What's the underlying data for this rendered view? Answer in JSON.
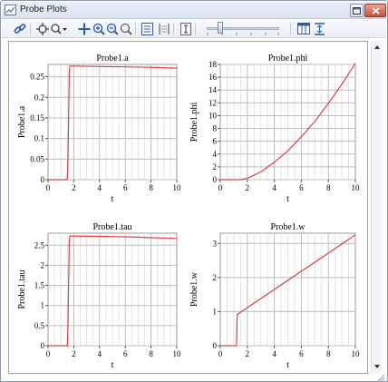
{
  "window": {
    "title": "Probe Plots",
    "accent": "#cc3b2c"
  },
  "toolbar": {
    "icons": [
      "link-icon",
      "pan-crosshair-icon",
      "zoom-axis-dropdown-icon",
      "move-icon",
      "zoom-in-icon",
      "zoom-out-icon",
      "zoom-reset-icon",
      "grid-view-icon",
      "align-icon",
      "text-cursor-icon",
      "layout-columns-icon",
      "fit-vertical-icon"
    ]
  },
  "plots": [
    {
      "title": "Probe1.a",
      "xlabel": "t",
      "ylabel": "Probe1.a",
      "xticks": [
        "0",
        "2",
        "4",
        "6",
        "8",
        "10"
      ],
      "yticks": [
        "0",
        "0.05",
        "0.1",
        "0.15",
        "0.2",
        "0.25"
      ]
    },
    {
      "title": "Probe1.phi",
      "xlabel": "t",
      "ylabel": "Probe1.phi",
      "xticks": [
        "0",
        "2",
        "4",
        "6",
        "8",
        "10"
      ],
      "yticks": [
        "0",
        "2",
        "4",
        "6",
        "8",
        "10",
        "12",
        "14",
        "16",
        "18"
      ]
    },
    {
      "title": "Probe1.tau",
      "xlabel": "t",
      "ylabel": "Probe1.tau",
      "xticks": [
        "0",
        "2",
        "4",
        "6",
        "8",
        "10"
      ],
      "yticks": [
        "0",
        "0.5",
        "1",
        "1.5",
        "2",
        "2.5"
      ]
    },
    {
      "title": "Probe1.w",
      "xlabel": "t",
      "ylabel": "Probe1.w",
      "xticks": [
        "0",
        "2",
        "4",
        "6",
        "8",
        "10"
      ],
      "yticks": [
        "0",
        "1",
        "2",
        "3"
      ]
    }
  ],
  "chart_data": [
    {
      "type": "line",
      "title": "Probe1.a",
      "xlabel": "t",
      "ylabel": "Probe1.a",
      "xlim": [
        0,
        10
      ],
      "ylim": [
        0,
        0.28
      ],
      "grid": true,
      "x": [
        0,
        1.5,
        1.55,
        1.6,
        1.65,
        1.7,
        2,
        4,
        6,
        8,
        10
      ],
      "y": [
        0,
        0,
        0.05,
        0.15,
        0.26,
        0.276,
        0.276,
        0.275,
        0.274,
        0.273,
        0.271
      ],
      "color": "#e04040"
    },
    {
      "type": "line",
      "title": "Probe1.phi",
      "xlabel": "t",
      "ylabel": "Probe1.phi",
      "xlim": [
        0,
        10
      ],
      "ylim": [
        0,
        18
      ],
      "grid": true,
      "x": [
        0,
        1.5,
        2,
        3,
        4,
        5,
        6,
        7,
        8,
        9,
        10
      ],
      "y": [
        0,
        0,
        0.2,
        1.2,
        2.7,
        4.5,
        6.7,
        9.1,
        11.9,
        14.9,
        18.2
      ],
      "color": "#e04040"
    },
    {
      "type": "line",
      "title": "Probe1.tau",
      "xlabel": "t",
      "ylabel": "Probe1.tau",
      "xlim": [
        0,
        10
      ],
      "ylim": [
        0,
        2.8
      ],
      "grid": true,
      "x": [
        0,
        1.5,
        1.55,
        1.6,
        1.65,
        1.7,
        2,
        4,
        6,
        8,
        10
      ],
      "y": [
        0,
        0,
        0.5,
        1.6,
        2.6,
        2.73,
        2.73,
        2.72,
        2.71,
        2.69,
        2.67
      ],
      "color": "#e04040"
    },
    {
      "type": "line",
      "title": "Probe1.w",
      "xlabel": "t",
      "ylabel": "Probe1.w",
      "xlim": [
        0,
        10
      ],
      "ylim": [
        0,
        3.3
      ],
      "grid": true,
      "x": [
        0,
        1.2,
        1.25,
        1.3,
        10
      ],
      "y": [
        0,
        0,
        0.9,
        0.93,
        3.25
      ],
      "color": "#e04040"
    }
  ]
}
